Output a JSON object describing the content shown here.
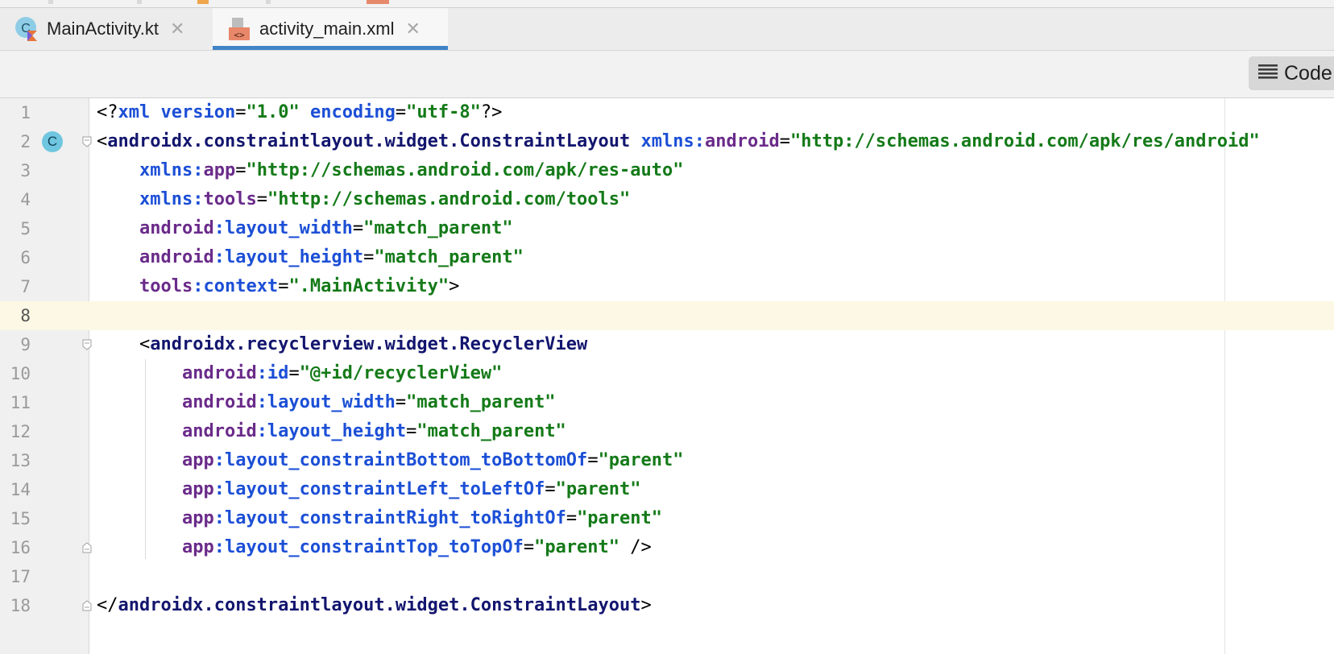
{
  "tabs": [
    {
      "label": "MainActivity.kt",
      "close": "✕",
      "icon": "kotlin-class-icon",
      "active": false
    },
    {
      "label": "activity_main.xml",
      "close": "✕",
      "icon": "xml-layout-file-icon",
      "active": true
    }
  ],
  "toolbar": {
    "view_mode_label": "Code",
    "view_mode_icon": "lines-icon"
  },
  "colors": {
    "accent": "#3f84c7",
    "tag": "#13166e",
    "attribute": "#1c4fd6",
    "namespace": "#6a2b8a",
    "string": "#147a18",
    "current_line": "#fcf8e5"
  },
  "editor": {
    "current_line": 8,
    "lines": [
      {
        "n": "1",
        "tokens": [
          [
            "punc",
            "<"
          ],
          [
            "punc",
            "?"
          ],
          [
            "attr",
            "xml"
          ],
          [
            "punc",
            " "
          ],
          [
            "attr",
            "version"
          ],
          [
            "punc",
            "="
          ],
          [
            "str",
            "\"1.0\""
          ],
          [
            "punc",
            " "
          ],
          [
            "attr",
            "encoding"
          ],
          [
            "punc",
            "="
          ],
          [
            "str",
            "\"utf-8\""
          ],
          [
            "punc",
            "?>"
          ]
        ]
      },
      {
        "n": "2",
        "tokens": [
          [
            "punc",
            "<"
          ],
          [
            "tag",
            "androidx.constraintlayout.widget.ConstraintLayout"
          ],
          [
            "punc",
            " "
          ],
          [
            "attr",
            "xmlns:"
          ],
          [
            "ns",
            "android"
          ],
          [
            "punc",
            "="
          ],
          [
            "str",
            "\"http://schemas.android.com/apk/res/android\""
          ]
        ]
      },
      {
        "n": "3",
        "tokens": [
          [
            "punc",
            "    "
          ],
          [
            "attr",
            "xmlns:"
          ],
          [
            "ns",
            "app"
          ],
          [
            "punc",
            "="
          ],
          [
            "str",
            "\"http://schemas.android.com/apk/res-auto\""
          ]
        ]
      },
      {
        "n": "4",
        "tokens": [
          [
            "punc",
            "    "
          ],
          [
            "attr",
            "xmlns:"
          ],
          [
            "ns",
            "tools"
          ],
          [
            "punc",
            "="
          ],
          [
            "str",
            "\"http://schemas.android.com/tools\""
          ]
        ]
      },
      {
        "n": "5",
        "tokens": [
          [
            "punc",
            "    "
          ],
          [
            "ns",
            "android"
          ],
          [
            "attr",
            ":layout_width"
          ],
          [
            "punc",
            "="
          ],
          [
            "str",
            "\"match_parent\""
          ]
        ]
      },
      {
        "n": "6",
        "tokens": [
          [
            "punc",
            "    "
          ],
          [
            "ns",
            "android"
          ],
          [
            "attr",
            ":layout_height"
          ],
          [
            "punc",
            "="
          ],
          [
            "str",
            "\"match_parent\""
          ]
        ]
      },
      {
        "n": "7",
        "tokens": [
          [
            "punc",
            "    "
          ],
          [
            "ns",
            "tools"
          ],
          [
            "attr",
            ":context"
          ],
          [
            "punc",
            "="
          ],
          [
            "str",
            "\".MainActivity\""
          ],
          [
            "punc",
            ">"
          ]
        ]
      },
      {
        "n": "8",
        "tokens": []
      },
      {
        "n": "9",
        "tokens": [
          [
            "punc",
            "    <"
          ],
          [
            "tag",
            "androidx.recyclerview.widget.RecyclerView"
          ]
        ]
      },
      {
        "n": "10",
        "tokens": [
          [
            "punc",
            "        "
          ],
          [
            "ns",
            "android"
          ],
          [
            "attr",
            ":id"
          ],
          [
            "punc",
            "="
          ],
          [
            "str",
            "\"@+id/recyclerView\""
          ]
        ]
      },
      {
        "n": "11",
        "tokens": [
          [
            "punc",
            "        "
          ],
          [
            "ns",
            "android"
          ],
          [
            "attr",
            ":layout_width"
          ],
          [
            "punc",
            "="
          ],
          [
            "str",
            "\"match_parent\""
          ]
        ]
      },
      {
        "n": "12",
        "tokens": [
          [
            "punc",
            "        "
          ],
          [
            "ns",
            "android"
          ],
          [
            "attr",
            ":layout_height"
          ],
          [
            "punc",
            "="
          ],
          [
            "str",
            "\"match_parent\""
          ]
        ]
      },
      {
        "n": "13",
        "tokens": [
          [
            "punc",
            "        "
          ],
          [
            "ns",
            "app"
          ],
          [
            "attr",
            ":layout_constraintBottom_toBottomOf"
          ],
          [
            "punc",
            "="
          ],
          [
            "str",
            "\"parent\""
          ]
        ]
      },
      {
        "n": "14",
        "tokens": [
          [
            "punc",
            "        "
          ],
          [
            "ns",
            "app"
          ],
          [
            "attr",
            ":layout_constraintLeft_toLeftOf"
          ],
          [
            "punc",
            "="
          ],
          [
            "str",
            "\"parent\""
          ]
        ]
      },
      {
        "n": "15",
        "tokens": [
          [
            "punc",
            "        "
          ],
          [
            "ns",
            "app"
          ],
          [
            "attr",
            ":layout_constraintRight_toRightOf"
          ],
          [
            "punc",
            "="
          ],
          [
            "str",
            "\"parent\""
          ]
        ]
      },
      {
        "n": "16",
        "tokens": [
          [
            "punc",
            "        "
          ],
          [
            "ns",
            "app"
          ],
          [
            "attr",
            ":layout_constraintTop_toTopOf"
          ],
          [
            "punc",
            "="
          ],
          [
            "str",
            "\"parent\""
          ],
          [
            "punc",
            " />"
          ]
        ]
      },
      {
        "n": "17",
        "tokens": []
      },
      {
        "n": "18",
        "tokens": [
          [
            "punc",
            "</"
          ],
          [
            "tag",
            "androidx.constraintlayout.widget.ConstraintLayout"
          ],
          [
            "punc",
            ">"
          ]
        ]
      }
    ],
    "fold_markers": [
      {
        "line": 2,
        "type": "open"
      },
      {
        "line": 9,
        "type": "open"
      },
      {
        "line": 16,
        "type": "close"
      },
      {
        "line": 18,
        "type": "close"
      }
    ],
    "gutter_icons": [
      {
        "line": 2,
        "icon": "class-icon",
        "letter": "C"
      }
    ]
  }
}
